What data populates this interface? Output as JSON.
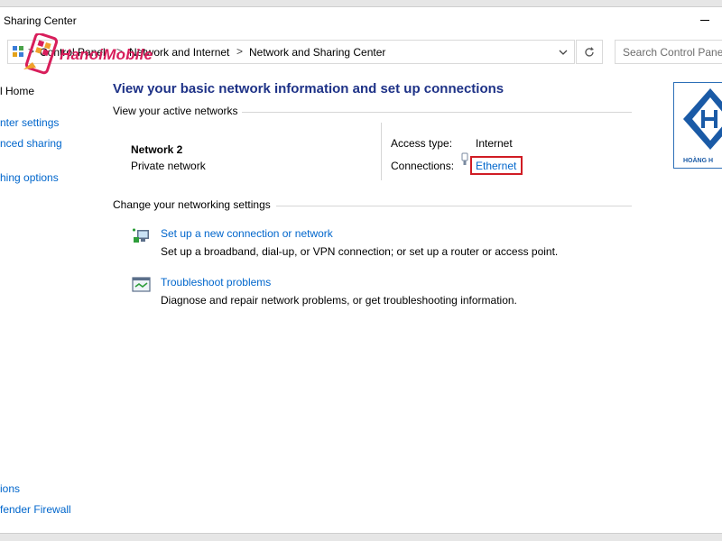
{
  "window": {
    "title": "Sharing Center"
  },
  "address_bar": {
    "crumbs": [
      "Control Panel",
      "Network and Internet",
      "Network and Sharing Center"
    ],
    "separator": ">"
  },
  "search": {
    "placeholder": "Search Control Panel"
  },
  "watermark": {
    "text": "HanoiMobile"
  },
  "brand_badge": {
    "text": "HOÀNG H"
  },
  "sidebar": {
    "home": "l Home",
    "items": [
      "nter settings",
      "nced sharing",
      "hing options"
    ],
    "see_also": [
      "ions",
      "fender Firewall"
    ]
  },
  "main": {
    "heading": "View your basic network information and set up connections",
    "active_networks_label": "View your active networks",
    "network": {
      "name": "Network 2",
      "category": "Private network",
      "access_type_label": "Access type:",
      "access_type_value": "Internet",
      "connections_label": "Connections:",
      "connection_link": "Ethernet"
    },
    "change_settings_label": "Change your networking settings",
    "tasks": [
      {
        "title": "Set up a new connection or network",
        "description": "Set up a broadband, dial-up, or VPN connection; or set up a router or access point."
      },
      {
        "title": "Troubleshoot problems",
        "description": "Diagnose and repair network problems, or get troubleshooting information."
      }
    ]
  },
  "colors": {
    "link": "#0066cc",
    "heading": "#1e3287",
    "highlight": "#d01c24",
    "watermark": "#d81e5b"
  }
}
